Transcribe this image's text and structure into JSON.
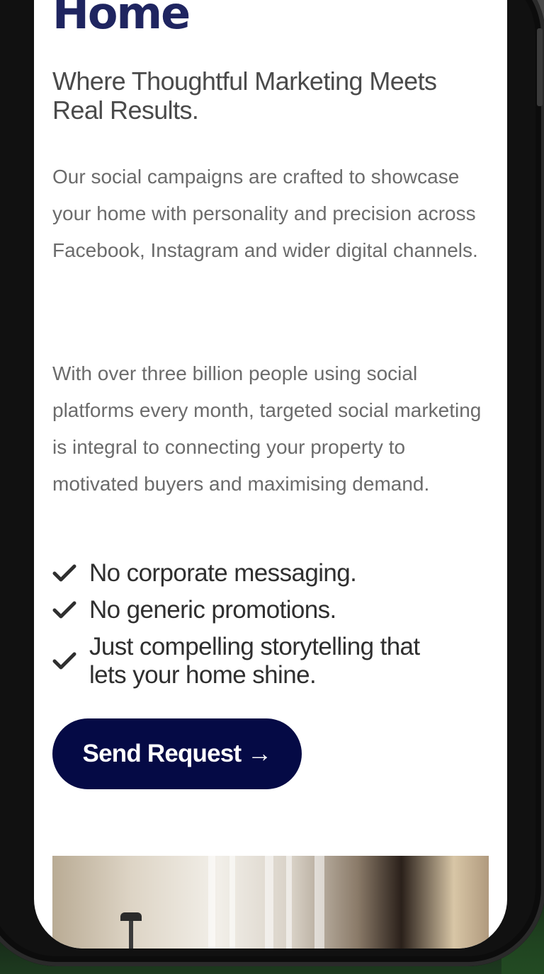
{
  "page": {
    "title": "Home",
    "subtitle": "Where Thoughtful Marketing Meets Real Results.",
    "paragraphs": [
      "Our social campaigns are crafted to showcase your home with personality and precision across Facebook, Instagram and wider digital channels.",
      "With over three billion people using social platforms every month, targeted social marketing is integral to connecting your property to motivated buyers and maximising demand."
    ],
    "checklist": [
      {
        "text": "No corporate messaging.",
        "icon": "checkmark-icon"
      },
      {
        "text": "No generic promotions.",
        "icon": "checkmark-icon"
      },
      {
        "text": "Just compelling storytelling that lets your home shine.",
        "icon": "checkmark-icon"
      }
    ],
    "cta": {
      "label": "Send Request →"
    }
  },
  "colors": {
    "title": "#1f2560",
    "button_bg": "#050a45",
    "button_text": "#ffffff",
    "body_text": "#6b6b6b"
  }
}
